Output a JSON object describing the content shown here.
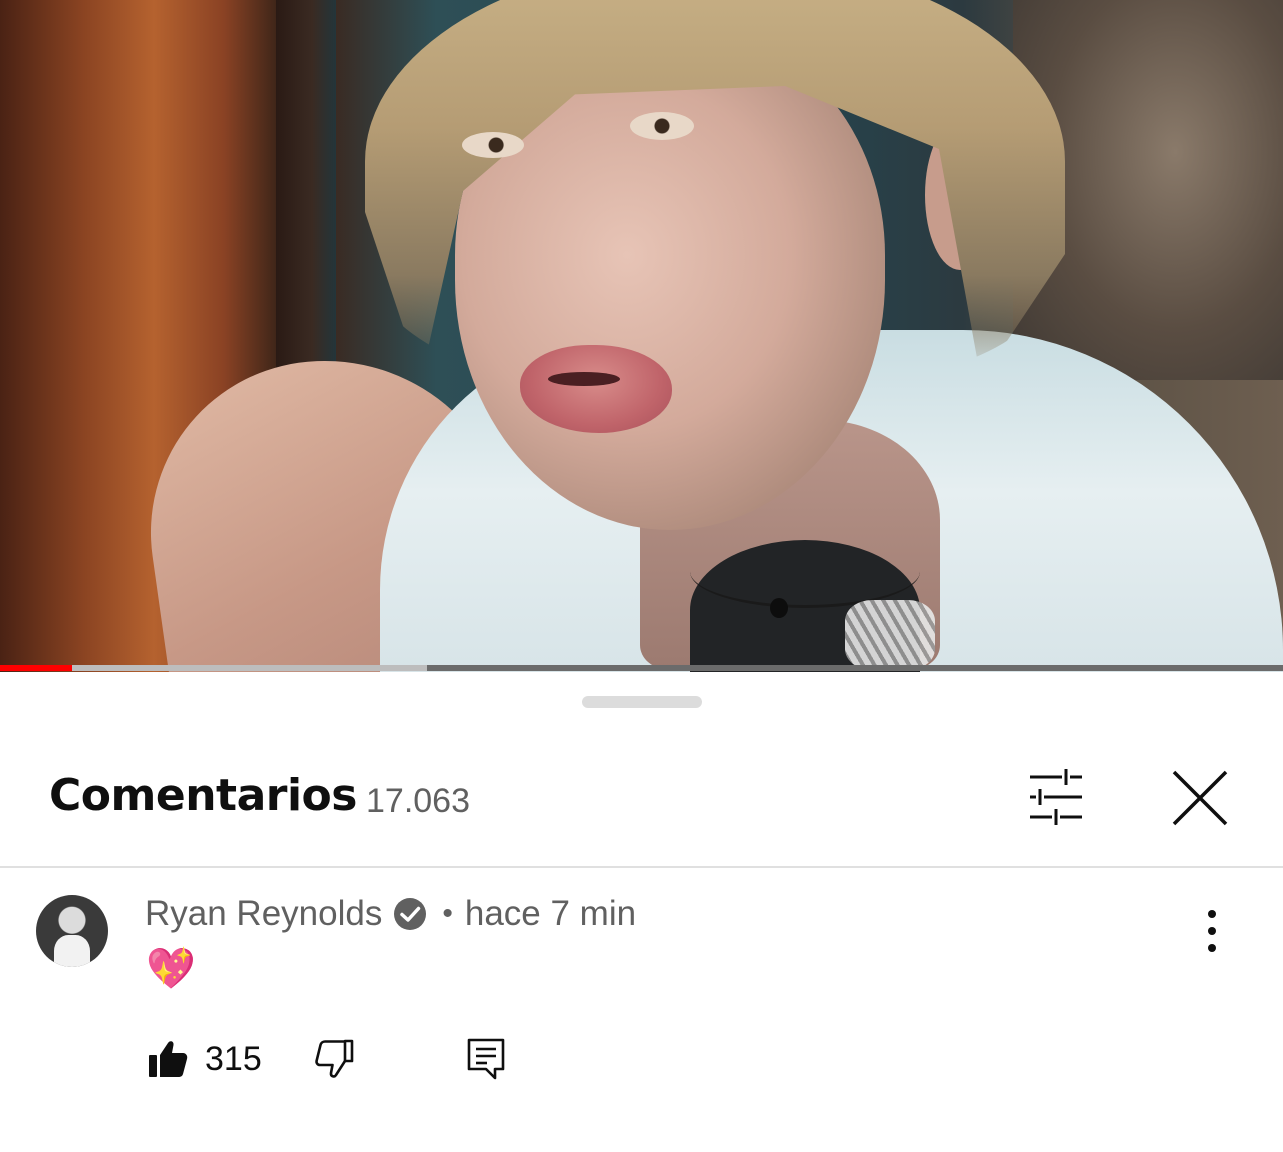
{
  "video": {
    "progress_played": 0.056,
    "progress_buffered": 0.333,
    "colors": {
      "played": "#ff0000",
      "buffered": "#bdbdbd",
      "track": "#6b6b6b"
    }
  },
  "comments_panel": {
    "title": "Comentarios",
    "count": "17.063",
    "icons": {
      "filter": "tune-sliders-icon",
      "close": "close-icon"
    }
  },
  "comment": {
    "author": "Ryan Reynolds",
    "verified": true,
    "separator": "•",
    "time": "hace 7 min",
    "text": "💖",
    "likes": "315",
    "icons": {
      "like": "thumbs-up-filled-icon",
      "dislike": "thumbs-down-outline-icon",
      "reply": "reply-comment-icon",
      "more": "more-vertical-icon",
      "verified": "verified-check-icon"
    }
  }
}
